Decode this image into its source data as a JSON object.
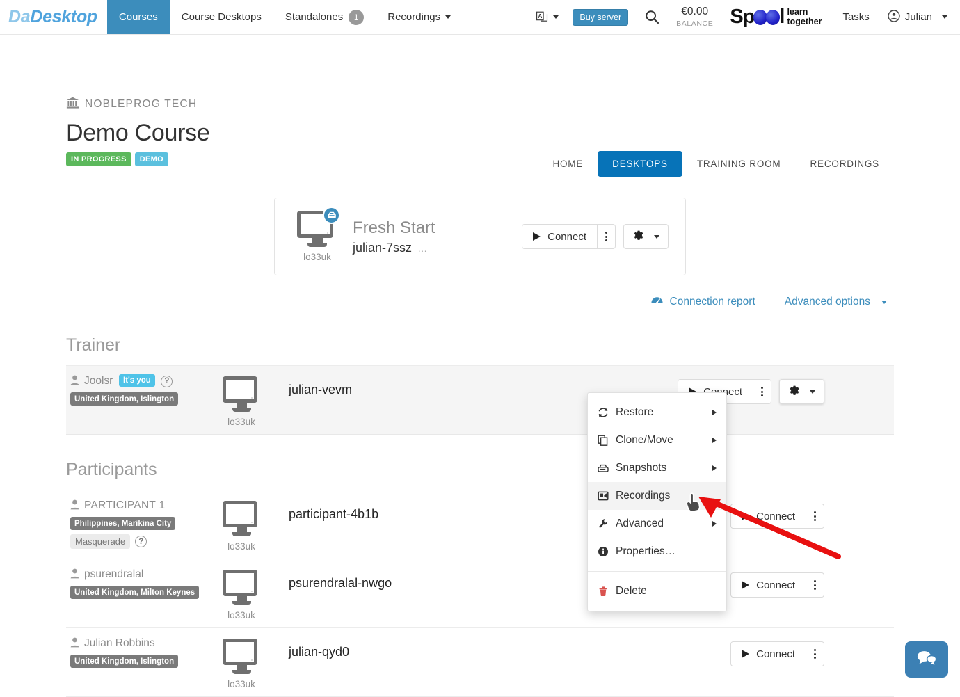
{
  "navbar": {
    "brand_prefix": "Da",
    "brand_suffix": "Desktop",
    "items": [
      {
        "label": "Courses",
        "badge": "",
        "caret": false,
        "active": true
      },
      {
        "label": "Course Desktops",
        "badge": "",
        "caret": false,
        "active": false
      },
      {
        "label": "Standalones",
        "badge": "1",
        "caret": false,
        "active": false
      },
      {
        "label": "Recordings",
        "badge": "",
        "caret": true,
        "active": false
      }
    ],
    "language_icon": "translate-icon",
    "buy_server_label": "Buy server",
    "search_icon": "search-icon",
    "balance_amount": "€0.00",
    "balance_label": "BALANCE",
    "logo": {
      "word_start": "Sp",
      "word_end": "l",
      "tagline_line1": "learn",
      "tagline_line2": "together"
    },
    "tasks_label": "Tasks",
    "user_label": "Julian",
    "colors": {
      "active_tab": "#3c8dbc",
      "buy_button": "#3c8dbc",
      "badge": "#999999"
    }
  },
  "breadcrumb": {
    "icon": "bank-icon",
    "text": "NOBLEPROG  TECH"
  },
  "course": {
    "title": "Demo Course",
    "pills": [
      {
        "label": "IN PROGRESS",
        "color": "#5cb85c"
      },
      {
        "label": "DEMO",
        "color": "#5bc0de"
      }
    ]
  },
  "course_tabs": [
    {
      "label": "HOME",
      "active": false
    },
    {
      "label": "DESKTOPS",
      "active": true
    },
    {
      "label": "TRAINING ROOM",
      "active": false
    },
    {
      "label": "RECORDINGS",
      "active": false
    }
  ],
  "fresh_start_card": {
    "monitor_tag": "lo33uk",
    "badge_icon": "disk-icon",
    "name": "Fresh Start",
    "subtitle": "julian-7ssz",
    "subtitle_more": "…",
    "connect_label": "Connect",
    "kebab_icon": "kebab-menu-icon",
    "gear_icon": "gear-icon"
  },
  "advanced_row": {
    "connection_report_icon": "gauge-icon",
    "connection_report_label": "Connection report",
    "advanced_options_label": "Advanced options"
  },
  "sections": [
    {
      "heading": "Trainer",
      "rows": [
        {
          "user_icon": "person-icon",
          "user_name": "Joolsr",
          "you_badge": "It's you",
          "help_icon": "question-icon",
          "location": "United Kingdom, Islington",
          "masquerade": null,
          "monitor_tag": "lo33uk",
          "desktop_name": "julian-vevm",
          "connect_label": "Connect",
          "has_gear": true,
          "highlight": true
        }
      ]
    },
    {
      "heading": "Participants",
      "rows": [
        {
          "user_icon": "person-icon",
          "user_name": "PARTICIPANT 1",
          "you_badge": null,
          "help_icon": null,
          "location": "Philippines, Marikina City",
          "masquerade": {
            "label": "Masquerade",
            "help_icon": "question-icon"
          },
          "monitor_tag": "lo33uk",
          "desktop_name": "participant-4b1b",
          "connect_label": "Connect",
          "has_gear": false,
          "highlight": false
        },
        {
          "user_icon": "person-icon",
          "user_name": "psurendralal",
          "you_badge": null,
          "help_icon": null,
          "location": "United Kingdom, Milton Keynes",
          "masquerade": null,
          "monitor_tag": "lo33uk",
          "desktop_name": "psurendralal-nwgo",
          "connect_label": "Connect",
          "has_gear": false,
          "highlight": false
        },
        {
          "user_icon": "person-icon",
          "user_name": "Julian Robbins",
          "you_badge": null,
          "help_icon": null,
          "location": "United Kingdom, Islington",
          "masquerade": null,
          "monitor_tag": "lo33uk",
          "desktop_name": "julian-qyd0",
          "connect_label": "Connect",
          "has_gear": false,
          "highlight": false
        }
      ]
    }
  ],
  "context_menu": {
    "items": [
      {
        "icon": "restore-icon",
        "label": "Restore",
        "submenu": true,
        "hover": false,
        "danger": false
      },
      {
        "icon": "clone-icon",
        "label": "Clone/Move",
        "submenu": true,
        "hover": false,
        "danger": false
      },
      {
        "icon": "snapshot-icon",
        "label": "Snapshots",
        "submenu": true,
        "hover": false,
        "danger": false
      },
      {
        "icon": "recordings-icon",
        "label": "Recordings",
        "submenu": false,
        "hover": true,
        "danger": false
      },
      {
        "icon": "wrench-icon",
        "label": "Advanced",
        "submenu": true,
        "hover": false,
        "danger": false
      },
      {
        "icon": "info-icon",
        "label": "Properties…",
        "submenu": false,
        "hover": false,
        "danger": false
      },
      {
        "separator": true
      },
      {
        "icon": "trash-icon",
        "label": "Delete",
        "submenu": false,
        "hover": false,
        "danger": true
      }
    ],
    "delete_color": "#d9534f"
  },
  "overlay": {
    "cursor_icon": "pointing-hand-cursor",
    "arrow_icon": "red-annotation-arrow",
    "arrow_color": "#e81010"
  },
  "chat_widget": {
    "icon": "chat-bubbles-icon",
    "color": "#3c80b4"
  }
}
